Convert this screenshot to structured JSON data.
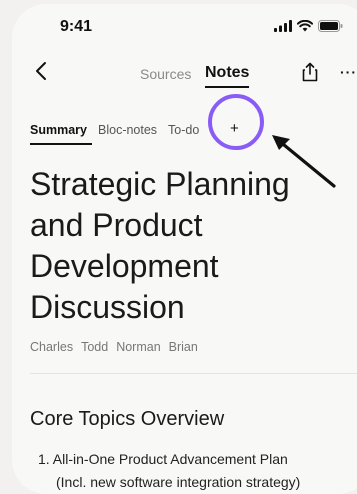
{
  "status_bar": {
    "time": "9:41"
  },
  "nav": {
    "sources_label": "Sources",
    "notes_label": "Notes",
    "more_label": "···"
  },
  "subtabs": {
    "summary": "Summary",
    "bloc_notes": "Bloc-notes",
    "todo": "To-do",
    "add": "+"
  },
  "doc": {
    "title": "Strategic Planning and Product Development Discussion",
    "participants": [
      "Charles",
      "Todd",
      "Norman",
      "Brian"
    ],
    "section_title": "Core Topics Overview",
    "list_item_1": "1. All-in-One Product Advancement Plan",
    "list_item_1_cont": "(Incl. new software integration strategy)"
  },
  "annotation": {
    "highlight_color": "#8a5cf6",
    "arrow_color": "#111111"
  }
}
